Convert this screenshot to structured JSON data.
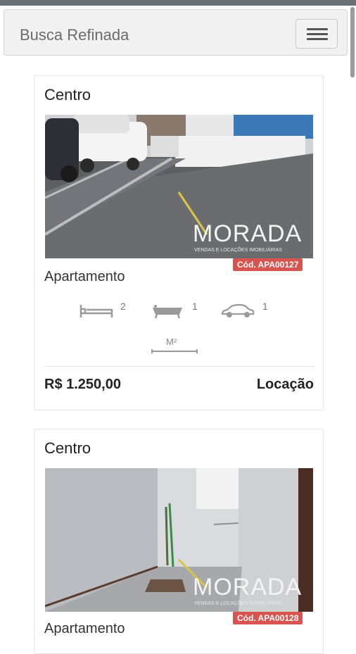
{
  "navbar": {
    "title": "Busca Refinada",
    "menu_icon": "hamburger-icon"
  },
  "listings": [
    {
      "neighborhood": "Centro",
      "code": "Cód. APA00127",
      "type": "Apartamento",
      "features": {
        "bedrooms": "2",
        "bathrooms": "1",
        "parking": "1",
        "area_unit": "M²"
      },
      "price": "R$ 1.250,00",
      "purpose": "Locação",
      "watermark": "MORADA",
      "photo": "parking-lot-photo"
    },
    {
      "neighborhood": "Centro",
      "code": "Cód. APA00128",
      "type": "Apartamento",
      "watermark": "MORADA",
      "photo": "empty-room-photo"
    }
  ],
  "colors": {
    "badge": "#d9534f",
    "navbar_bg": "#f1f1f1",
    "text": "#222222"
  }
}
